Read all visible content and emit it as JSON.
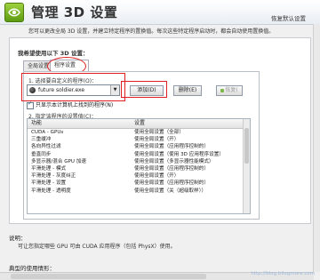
{
  "header": {
    "title": "管理 3D 设置",
    "restore_defaults": "恢复默认设置"
  },
  "intro": "您可以更改全局 3D 设置，并建立特定程序的置换值。每次这些特定程序启动时，都会自动使用置换值。",
  "section_title": "我希望使用以下 3D 设置：",
  "tabs": [
    {
      "label": "全局设置"
    },
    {
      "label": "程序设置"
    }
  ],
  "program_settings": {
    "step1_label": "1. 选择要自定义的程序(O)：",
    "selected_program": "future soldier.exe",
    "add_button": "添加(D)",
    "delete_button": "删除(E)",
    "restore_button": "恢复(",
    "checkbox_label": "只显示本计算机上找到的程序(N)",
    "step2_label": "2. 指定该程序的设置值(C)："
  },
  "settings_table": {
    "headers": [
      "功能",
      "设置"
    ],
    "rows": [
      {
        "feature": "CUDA - GPUs",
        "setting": "使用全局设置（全部）"
      },
      {
        "feature": "三重缓冲",
        "setting": "使用全局设置（开）"
      },
      {
        "feature": "各向异性过滤",
        "setting": "使用全局设置（应用程序控制的）"
      },
      {
        "feature": "垂直同步",
        "setting": "使用全局设置（使用 3D 应用程序设置）"
      },
      {
        "feature": "多显示器/混合 GPU 加速",
        "setting": "使用全局设置（多显示器性能模式）"
      },
      {
        "feature": "平滑处理 - 模式",
        "setting": "使用全局设置（应用程序控制的）"
      },
      {
        "feature": "平滑处理 - 灰度纠正",
        "setting": "使用全局设置（开）"
      },
      {
        "feature": "平滑处理 - 设置",
        "setting": "使用全局设置（应用程序控制的）"
      },
      {
        "feature": "平滑处理 - 透明度",
        "setting": "使用全局设置（关（超级取样））"
      }
    ]
  },
  "description": {
    "label": "说明：",
    "text": "可让您指定哪些 GPU 可由 CUDA 应用程序（包括 PhysX）使用。"
  },
  "usage_label": "典型的使用情形：",
  "watermark": "http://blog.bilogmore.com"
}
